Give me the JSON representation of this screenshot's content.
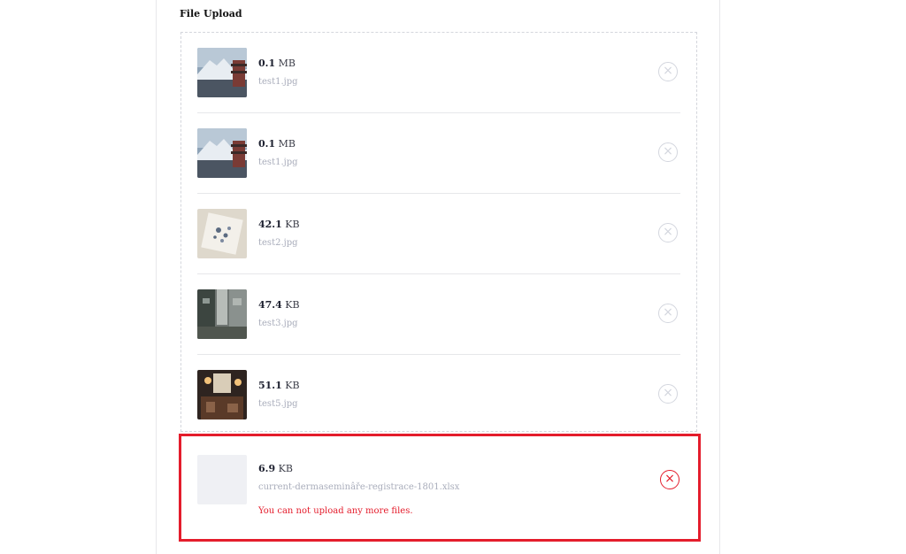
{
  "section": {
    "title": "File Upload"
  },
  "files": [
    {
      "size_value": "0.1",
      "size_unit": " MB",
      "name": "test1.jpg",
      "thumb": "mountain-temple"
    },
    {
      "size_value": "0.1",
      "size_unit": " MB",
      "name": "test1.jpg",
      "thumb": "mountain-temple"
    },
    {
      "size_value": "42.1",
      "size_unit": " KB",
      "name": "test2.jpg",
      "thumb": "paper-notes"
    },
    {
      "size_value": "47.4",
      "size_unit": " KB",
      "name": "test3.jpg",
      "thumb": "city-street"
    },
    {
      "size_value": "51.1",
      "size_unit": " KB",
      "name": "test5.jpg",
      "thumb": "restaurant-interior"
    }
  ],
  "error_file": {
    "size_value": "6.9",
    "size_unit": " KB",
    "name": "current-dermaseminâře-registrace-1801.xlsx",
    "error": "You can not upload any more files."
  },
  "icons": {
    "remove": "×"
  },
  "colors": {
    "error": "#e41d2c",
    "muted_text": "#a9adbb",
    "border": "#d4d6dc"
  }
}
